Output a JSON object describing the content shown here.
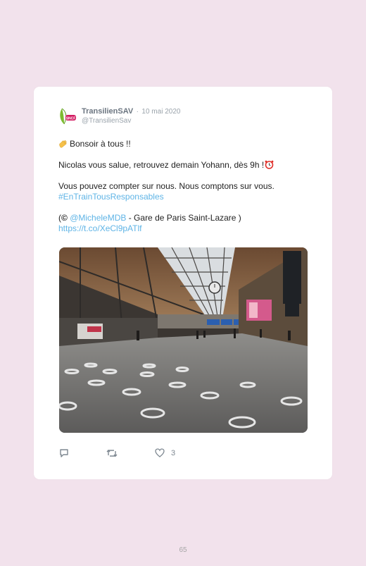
{
  "tweet": {
    "display_name": "TransilienSAV",
    "separator": "·",
    "date": "10 mai 2020",
    "handle": "@TransilienSav",
    "avatar_icon": "transilien-sncf-logo",
    "line1_text": "Bonsoir à tous !!",
    "line2_text": "Nicolas vous salue, retrouvez demain Yohann, dès 9h !",
    "line3_text": "Vous pouvez compter sur nous. Nous comptons sur vous.",
    "hashtag": "#EnTrainTousResponsables",
    "credit_open": "(",
    "credit_symbol": "©",
    "mention": "@MicheleMDB",
    "credit_rest": " - Gare de Paris Saint-Lazare )",
    "short_link": "https://t.co/XeCl9pATlf",
    "photo_description_icon": "train-station-photo",
    "likes": "3",
    "link_color": "#5fb4e6"
  },
  "page": {
    "number": "65"
  }
}
